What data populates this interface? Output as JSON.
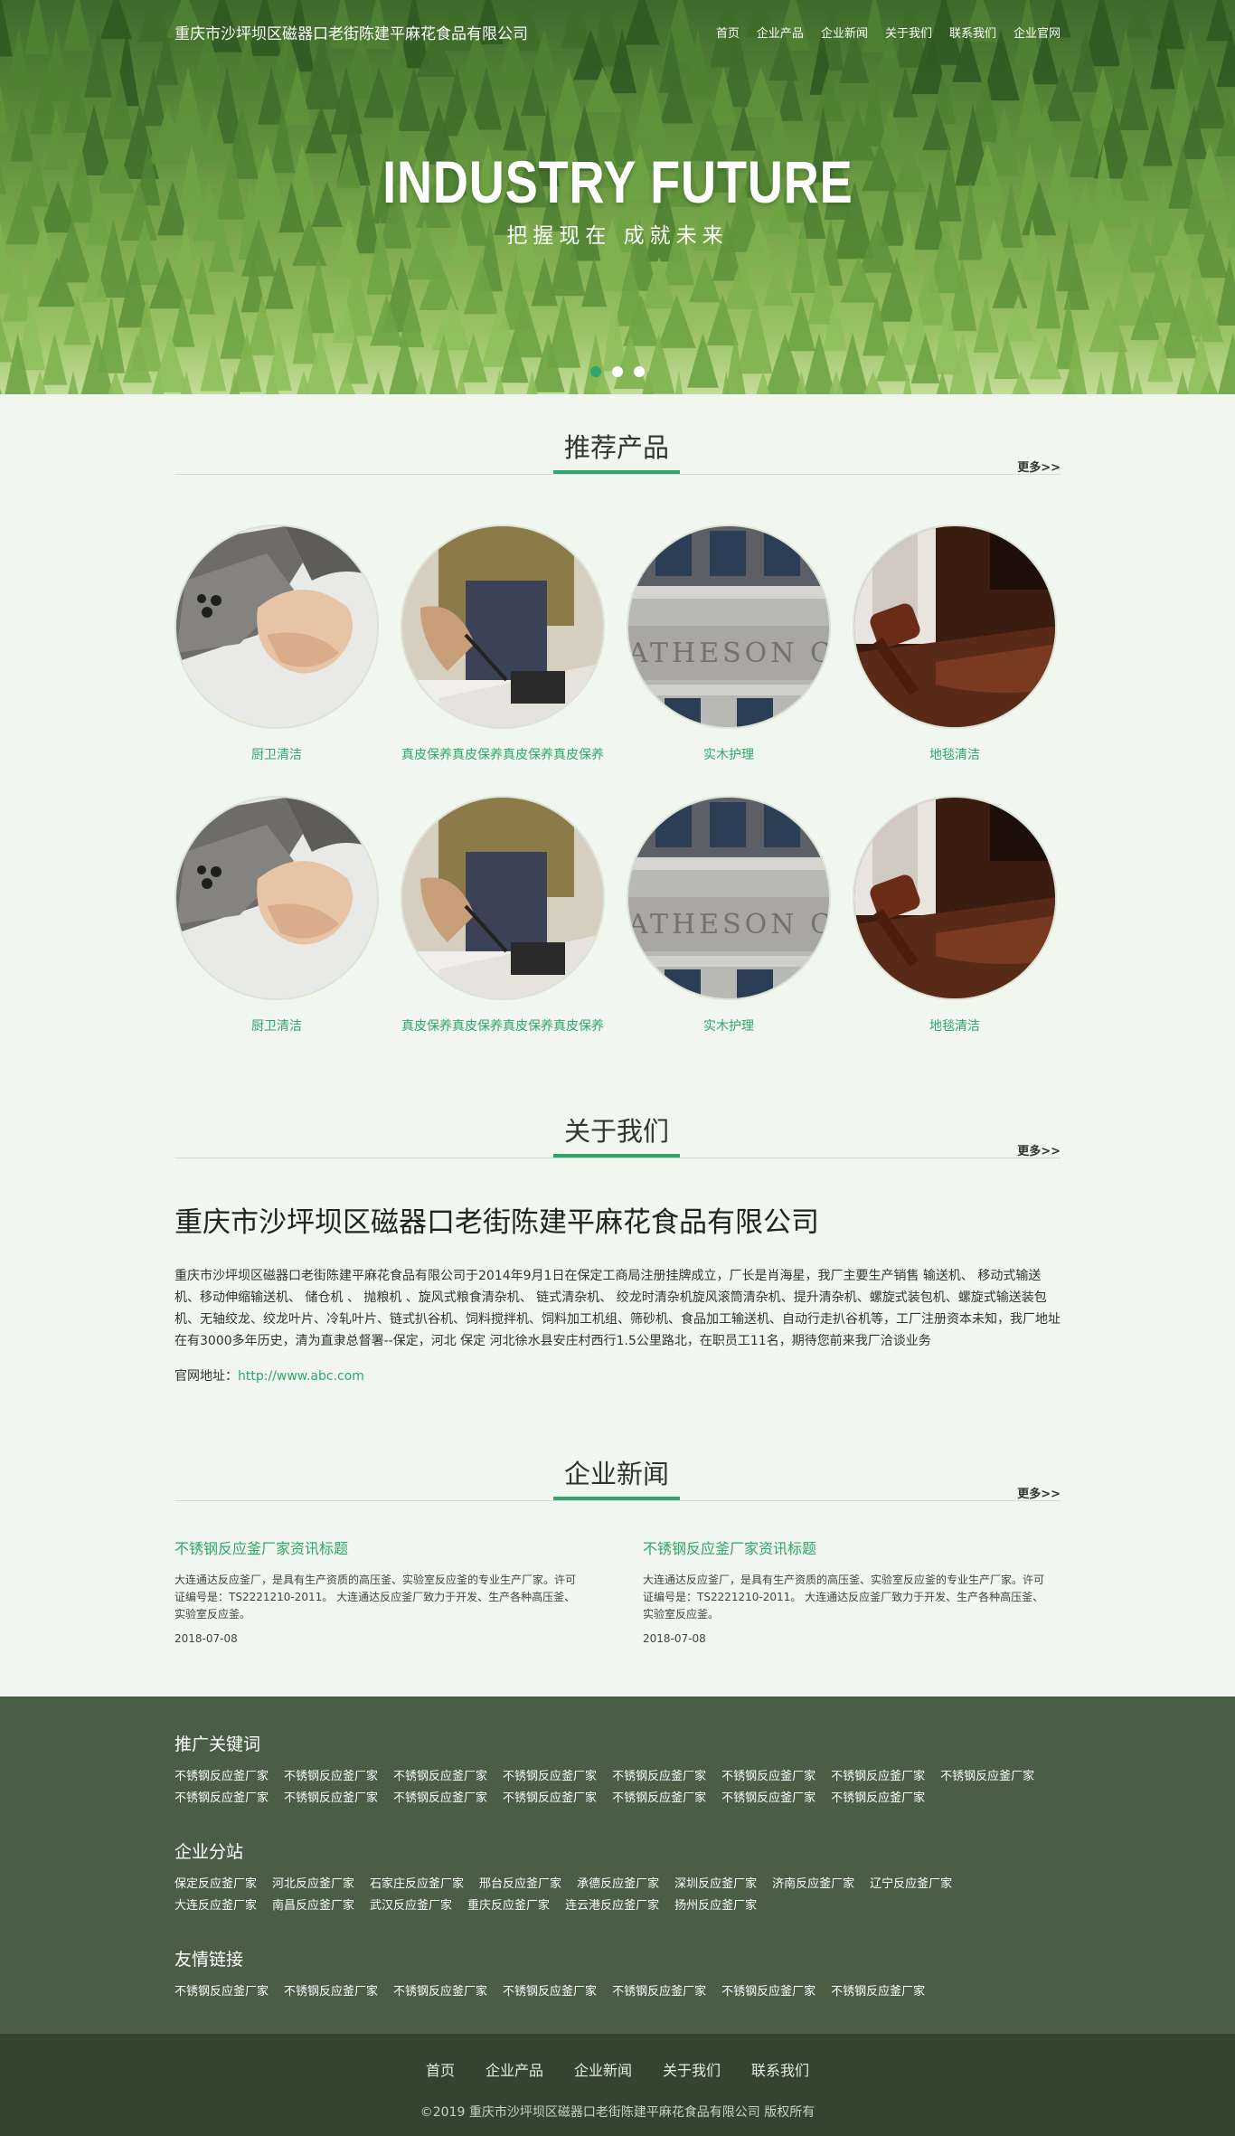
{
  "header": {
    "site_name": "重庆市沙坪坝区磁器口老街陈建平麻花食品有限公司",
    "nav": [
      "首页",
      "企业产品",
      "企业新闻",
      "关于我们",
      "联系我们",
      "企业官网"
    ]
  },
  "hero": {
    "title": "INDUSTRY FUTURE",
    "subtitle": "把握现在 成就未来",
    "slides": 3,
    "active_slide": 1
  },
  "products": {
    "title": "推荐产品",
    "more": "更多>>",
    "items": [
      {
        "name": "厨卫清洁",
        "image": "handshake"
      },
      {
        "name": "真皮保养真皮保养真皮保养真皮保养",
        "image": "signing"
      },
      {
        "name": "实木护理",
        "image": "building"
      },
      {
        "name": "地毯清洁",
        "image": "gavel"
      },
      {
        "name": "厨卫清洁",
        "image": "handshake"
      },
      {
        "name": "真皮保养真皮保养真皮保养真皮保养",
        "image": "signing"
      },
      {
        "name": "实木护理",
        "image": "building"
      },
      {
        "name": "地毯清洁",
        "image": "gavel"
      }
    ]
  },
  "about": {
    "title": "关于我们",
    "more": "更多>>",
    "company": "重庆市沙坪坝区磁器口老街陈建平麻花食品有限公司",
    "text": "重庆市沙坪坝区磁器口老街陈建平麻花食品有限公司于2014年9月1日在保定工商局注册挂牌成立，厂长是肖海星，我厂主要生产销售 输送机、 移动式输送机、移动伸缩输送机、 储仓机 、 抛粮机 、旋风式粮食清杂机、 链式清杂机、 绞龙时清杂机旋风滚筒清杂机、提升清杂机、螺旋式装包机、螺旋式输送装包机、无轴绞龙、绞龙叶片、冷轧叶片、链式扒谷机、饲料搅拌机、饲料加工机组、筛砂机、食品加工输送机、自动行走扒谷机等，工厂注册资本未知，我厂地址在有3000多年历史，清为直隶总督署--保定，河北 保定 河北徐水县安庄村西行1.5公里路北，在职员工11名，期待您前来我厂洽谈业务",
    "website_label": "官网地址：",
    "website_url": "http://www.abc.com"
  },
  "news": {
    "title": "企业新闻",
    "more": "更多>>",
    "items": [
      {
        "title": "不锈钢反应釜厂家资讯标题",
        "summary": "大连通达反应釜厂，是具有生产资质的高压釜、实验室反应釜的专业生产厂家。许可证编号是：TS2221210-2011。 大连通达反应釜厂致力于开发、生产各种高压釜、实验室反应釜。",
        "date": "2018-07-08"
      },
      {
        "title": "不锈钢反应釜厂家资讯标题",
        "summary": "大连通达反应釜厂，是具有生产资质的高压釜、实验室反应釜的专业生产厂家。许可证编号是：TS2221210-2011。 大连通达反应釜厂致力于开发、生产各种高压釜、实验室反应釜。",
        "date": "2018-07-08"
      }
    ]
  },
  "footer_links": {
    "keywords_title": "推广关键词",
    "keywords": [
      "不锈钢反应釜厂家",
      "不锈钢反应釜厂家",
      "不锈钢反应釜厂家",
      "不锈钢反应釜厂家",
      "不锈钢反应釜厂家",
      "不锈钢反应釜厂家",
      "不锈钢反应釜厂家",
      "不锈钢反应釜厂家",
      "不锈钢反应釜厂家",
      "不锈钢反应釜厂家",
      "不锈钢反应釜厂家",
      "不锈钢反应釜厂家",
      "不锈钢反应釜厂家",
      "不锈钢反应釜厂家",
      "不锈钢反应釜厂家"
    ],
    "branches_title": "企业分站",
    "branches": [
      "保定反应釜厂家",
      "河北反应釜厂家",
      "石家庄反应釜厂家",
      "邢台反应釜厂家",
      "承德反应釜厂家",
      "深圳反应釜厂家",
      "济南反应釜厂家",
      "辽宁反应釜厂家",
      "大连反应釜厂家",
      "南昌反应釜厂家",
      "武汉反应釜厂家",
      "重庆反应釜厂家",
      "连云港反应釜厂家",
      "扬州反应釜厂家"
    ],
    "friends_title": "友情链接",
    "friends": [
      "不锈钢反应釜厂家",
      "不锈钢反应釜厂家",
      "不锈钢反应釜厂家",
      "不锈钢反应釜厂家",
      "不锈钢反应釜厂家",
      "不锈钢反应釜厂家",
      "不锈钢反应釜厂家"
    ]
  },
  "footer": {
    "nav": [
      "首页",
      "企业产品",
      "企业新闻",
      "关于我们",
      "联系我们"
    ],
    "copyright": "©2019 重庆市沙坪坝区磁器口老街陈建平麻花食品有限公司 版权所有"
  },
  "colors": {
    "accent": "#2fa66b",
    "page_bg": "#f1f6ee",
    "footer_links_bg": "#4a5e46",
    "footer_bottom_bg": "#34452f"
  }
}
